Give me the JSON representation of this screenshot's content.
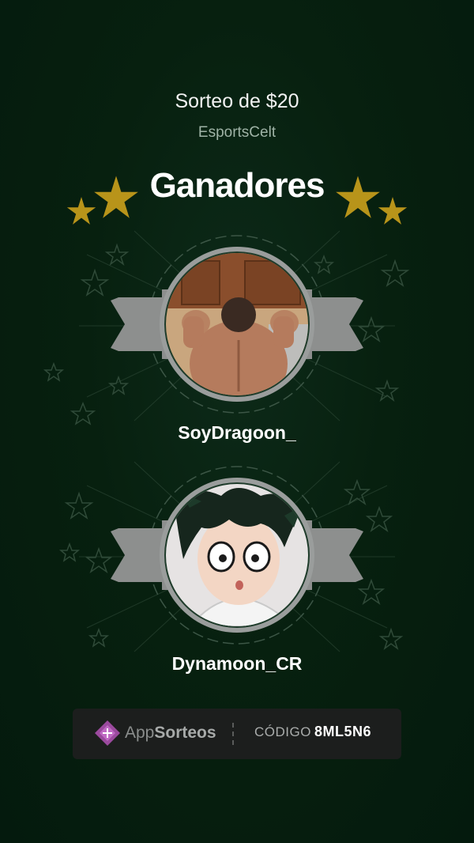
{
  "header": {
    "title": "Sorteo de $20",
    "subtitle": "EsportsCelt",
    "heading": "Ganadores"
  },
  "winners": [
    {
      "name": "SoyDragoon_",
      "avatar": "person-back-flexing-photo"
    },
    {
      "name": "Dynamoon_CR",
      "avatar": "anime-character-green-hair"
    }
  ],
  "footer": {
    "brand_app": "App",
    "brand_sorteos": "Sorteos",
    "code_label": "CÓDIGO",
    "code_value": "8ML5N6"
  },
  "colors": {
    "background": "#061e0f",
    "star_gold": "#b8941a",
    "ribbon_gray": "#8d8f8e",
    "ring_gray": "#9a9d9c",
    "footer_bg": "#1c1e1d"
  }
}
